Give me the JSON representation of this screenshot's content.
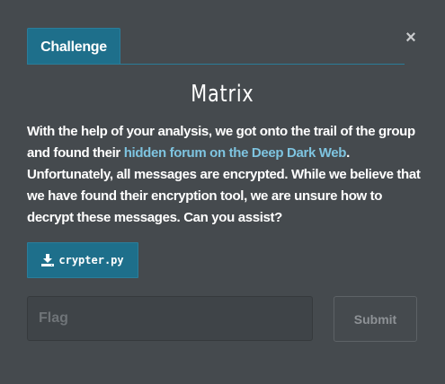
{
  "dialog": {
    "close_glyph": "×",
    "tab_label": "Challenge",
    "title": "Matrix",
    "description": {
      "before_link": "With the help of your analysis, we got onto the trail of the group and found their ",
      "link_text": "hidden forum on the Deep Dark Web",
      "after_link": ". Unfortunately, all messages are encrypted. While we believe that we have found their encryption tool, we are unsure how to decrypt these messages. Can you assist?"
    },
    "file": {
      "icon": "download-icon",
      "name": "crypter.py"
    },
    "flag_input": {
      "placeholder": "Flag",
      "value": ""
    },
    "submit_label": "Submit"
  },
  "colors": {
    "background": "#454a4e",
    "accent": "#1e6f8b",
    "link": "#7ec4e0"
  }
}
